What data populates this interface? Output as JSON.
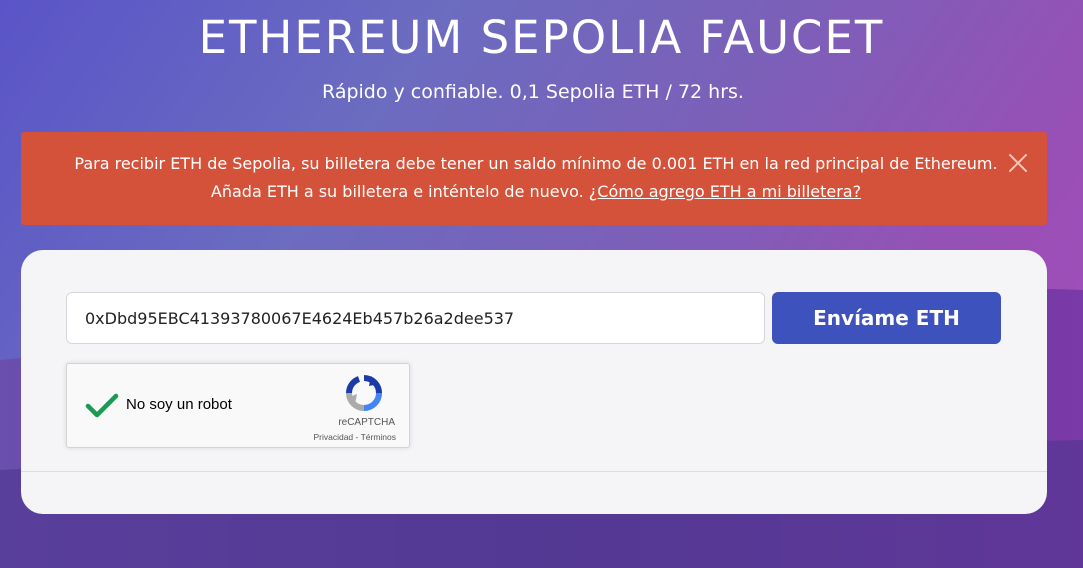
{
  "header": {
    "title": "ETHEREUM SEPOLIA FAUCET",
    "subtitle": "Rápido y confiable. 0,1 Sepolia ETH / 72 hrs."
  },
  "alert": {
    "message": "Para recibir ETH de Sepolia, su billetera debe tener un saldo mínimo de 0.001 ETH en la red principal de Ethereum. Añada ETH a su billetera e inténtelo de nuevo.",
    "link_text": "¿Cómo agrego ETH a mi billetera?",
    "close_icon": "close-icon",
    "color": "#d35239"
  },
  "form": {
    "address_value": "0xDbd95EBC41393780067E4624Eb457b26a2dee537",
    "send_label": "Envíame ETH",
    "button_color": "#3e52bd"
  },
  "recaptcha": {
    "checked": true,
    "label": "No soy un robot",
    "brand": "reCAPTCHA",
    "privacy": "Privacidad",
    "separator": " - ",
    "terms": "Términos"
  }
}
